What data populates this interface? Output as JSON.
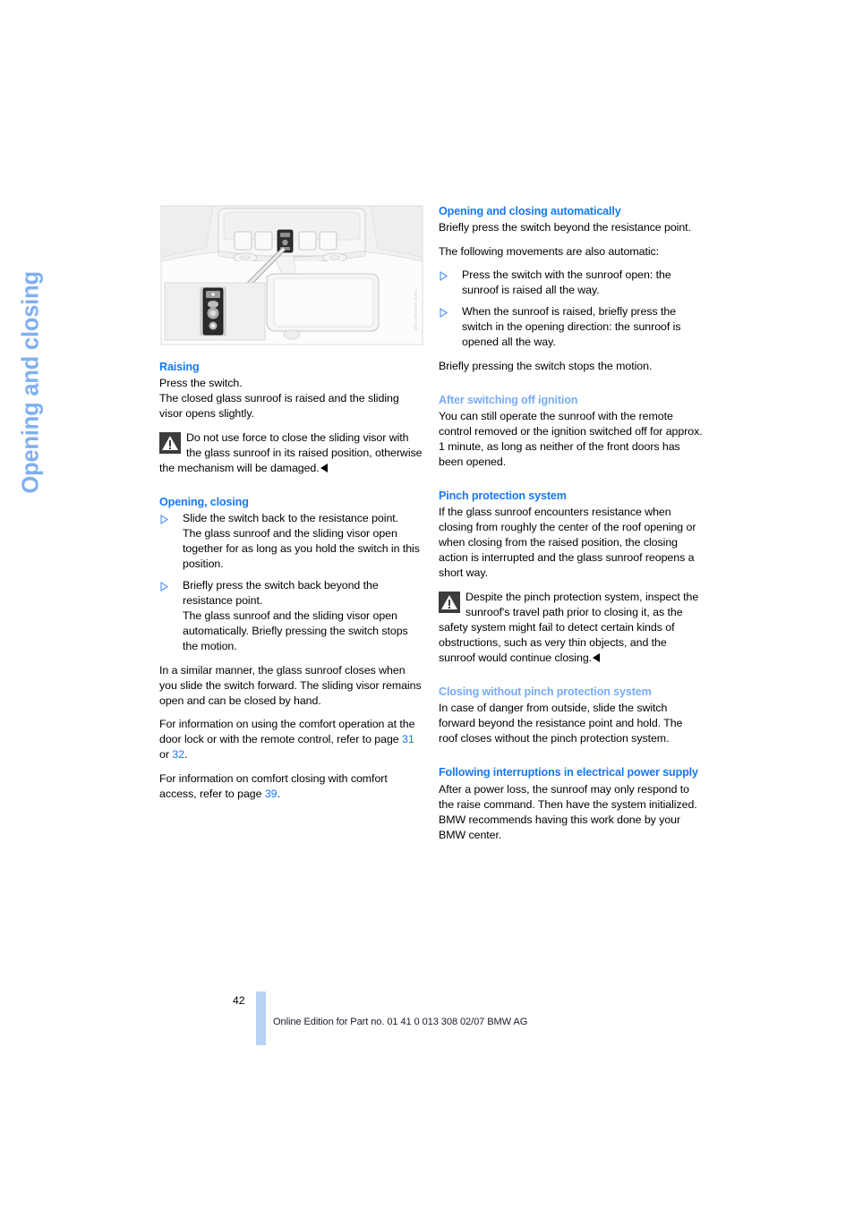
{
  "chapter": {
    "title": "Opening and closing"
  },
  "figure": {
    "name": "sunroof-switch-illustration",
    "id_text": "SAFE-VEHLIMIT-048"
  },
  "left_column": {
    "sections": [
      {
        "heading": "Raising",
        "heading_style": "strong",
        "blocks": [
          {
            "type": "paragraph",
            "text": "Press the switch."
          },
          {
            "type": "paragraph",
            "text": "The closed glass sunroof is raised and the sliding visor opens slightly."
          },
          {
            "type": "warning",
            "text": "Do not use force to close the sliding visor with the glass sunroof in its raised position, otherwise the mechanism will be damaged.",
            "end_marker": true
          }
        ]
      },
      {
        "heading": "Opening, closing",
        "heading_style": "strong",
        "blocks": [
          {
            "type": "bullets",
            "items": [
              "Slide the switch back to the resistance point.\nThe glass sunroof and the sliding visor open together for as long as you hold the switch in this position.",
              "Briefly press the switch back beyond the resistance point.\nThe glass sunroof and the sliding visor open automatically. Briefly pressing the switch stops the motion."
            ]
          },
          {
            "type": "paragraph",
            "text": "In a similar manner, the glass sunroof closes when you slide the switch forward. The sliding visor remains open and can be closed by hand."
          },
          {
            "type": "paragraph_refs",
            "parts": [
              {
                "t": "For information on using the comfort operation at the door lock or with the remote control, refer to page "
              },
              {
                "t": "31",
                "ref": true
              },
              {
                "t": " or "
              },
              {
                "t": "32",
                "ref": true
              },
              {
                "t": "."
              }
            ]
          },
          {
            "type": "paragraph_refs",
            "parts": [
              {
                "t": "For information on comfort closing with comfort access, refer to page "
              },
              {
                "t": "39",
                "ref": true
              },
              {
                "t": "."
              }
            ]
          }
        ]
      }
    ]
  },
  "right_column": {
    "sections": [
      {
        "heading": "Opening and closing automatically",
        "heading_style": "strong",
        "blocks": [
          {
            "type": "paragraph",
            "text": "Briefly press the switch beyond the resistance point."
          },
          {
            "type": "paragraph",
            "text": "The following movements are also automatic:"
          },
          {
            "type": "bullets",
            "items": [
              "Press the switch with the sunroof open: the sunroof is raised all the way.",
              "When the sunroof is raised, briefly press the switch in the opening direction: the sunroof is opened all the way."
            ]
          },
          {
            "type": "paragraph",
            "text": "Briefly pressing the switch stops the motion."
          }
        ]
      },
      {
        "heading": "After switching off ignition",
        "heading_style": "soft",
        "blocks": [
          {
            "type": "paragraph",
            "text": "You can still operate the sunroof with the remote control removed or the ignition switched off for approx. 1 minute, as long as neither of the front doors has been opened."
          }
        ]
      },
      {
        "heading": "Pinch protection system",
        "heading_style": "strong",
        "blocks": [
          {
            "type": "paragraph",
            "text": "If the glass sunroof encounters resistance when closing from roughly the center of the roof opening or when closing from the raised position, the closing action is interrupted and the glass sunroof reopens a short way."
          },
          {
            "type": "warning",
            "text": "Despite the pinch protection system, inspect the sunroof's travel path prior to closing it, as the safety system might fail to detect certain kinds of obstructions, such as very thin objects, and the sunroof would continue closing.",
            "end_marker": true
          }
        ]
      },
      {
        "heading": "Closing without pinch protection system",
        "heading_style": "soft",
        "blocks": [
          {
            "type": "paragraph",
            "text": "In case of danger from outside, slide the switch forward beyond the resistance point and hold. The roof closes without the pinch protection system."
          }
        ]
      },
      {
        "heading": "Following interruptions in electrical power supply",
        "heading_style": "strong",
        "blocks": [
          {
            "type": "paragraph",
            "text": "After a power loss, the sunroof may only respond to the raise command. Then have the system initialized. BMW recommends having this work done by your BMW center."
          }
        ]
      }
    ]
  },
  "footer": {
    "page_number": "42",
    "text": "Online Edition for Part no. 01 41 0 013 308 02/07 BMW AG"
  },
  "colors": {
    "heading_blue": "#1878F0",
    "heading_blue_soft": "#78ACF5",
    "chapter_tab_blue": "#7FB0F2",
    "footer_bar_blue": "#B9D3F5",
    "warning_icon_bg": "#3C3C3C"
  }
}
